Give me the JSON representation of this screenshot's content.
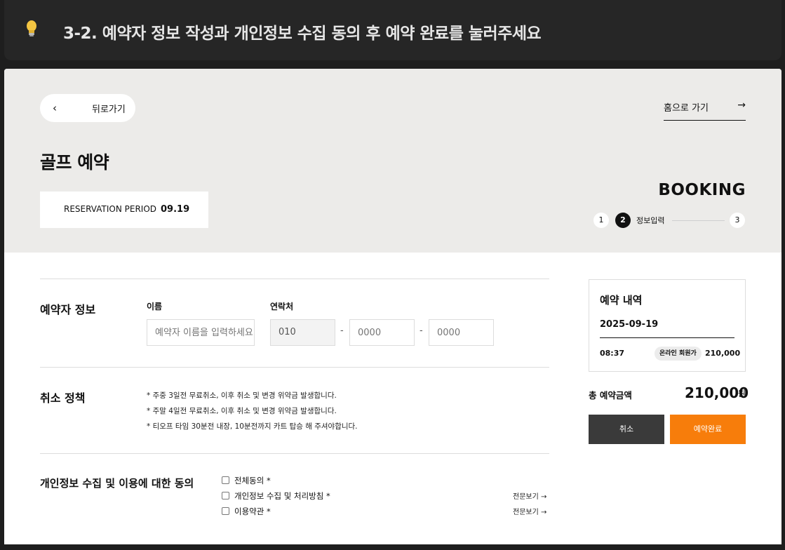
{
  "banner": {
    "icon": "lightbulb-icon",
    "title": "3-2. 예약자 정보 작성과 개인정보 수집 동의 후 예약 완료를 눌러주세요"
  },
  "nav": {
    "back_label": "뒤로가기",
    "back_icon": "chevron-left-icon",
    "home_label": "홈으로 가기",
    "home_icon": "arrow-right-icon"
  },
  "header": {
    "title": "골프 예약",
    "period_label": "RESERVATION PERIOD",
    "period_value": "09.19",
    "booking_label": "BOOKING"
  },
  "steps": [
    {
      "number": "1"
    },
    {
      "number": "2",
      "label": "정보입력",
      "active": true
    },
    {
      "number": "3"
    }
  ],
  "reserver": {
    "section_title": "예약자 정보",
    "name_label": "이름",
    "name_placeholder": "예약자 이름을 입력하세요",
    "contact_label": "연락처",
    "phone_prefix": "010",
    "phone_mid_placeholder": "0000",
    "phone_last_placeholder": "0000",
    "separator": "-"
  },
  "cancellation": {
    "section_title": "취소 정책",
    "lines": [
      "* 주중 3일전 무료취소, 이후 취소 및 변경 위약금 발생합니다.",
      "* 주말 4일전 무료취소, 이후 취소 및 변경 위약금 발생합니다.",
      "* 티오프 타임 30분전 내장, 10분전까지 카트 탑승 해 주셔야합니다."
    ]
  },
  "consent": {
    "section_title": "개인정보 수집 및 이용에 대한 동의",
    "items": [
      {
        "label": "전체동의 *"
      },
      {
        "label": "개인정보 수집 및 처리방침 *",
        "link": "전문보기"
      },
      {
        "label": "이용약관 *",
        "link": "전문보기"
      }
    ]
  },
  "summary": {
    "title": "예약 내역",
    "date": "2025-09-19",
    "time": "08:37",
    "badge": "온라인 회원가",
    "price": "210,000",
    "total_label": "총 예약금액",
    "total_value": "210,000",
    "total_unit": "원"
  },
  "buttons": {
    "cancel": "취소",
    "confirm": "예약완료"
  },
  "colors": {
    "accent": "#f77d0b",
    "dark_button": "#3a3a3a",
    "hero_bg": "#ecebe9"
  }
}
